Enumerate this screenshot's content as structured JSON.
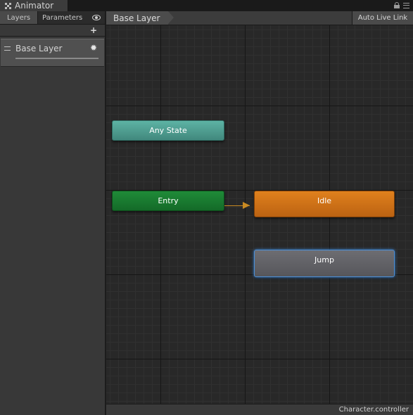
{
  "window": {
    "title": "Animator",
    "icons": [
      "animator-icon",
      "lock-icon",
      "menu-icon"
    ]
  },
  "left_panel": {
    "tabs": [
      {
        "label": "Layers",
        "active": true
      },
      {
        "label": "Parameters",
        "active": false
      }
    ],
    "icons": [
      "eye-icon",
      "plus-icon"
    ],
    "layers": [
      {
        "name": "Base Layer",
        "icons": [
          "drag-handle-icon",
          "gear-icon"
        ]
      }
    ]
  },
  "graph": {
    "breadcrumb": "Base Layer",
    "auto_live_link": "Auto Live Link",
    "nodes": {
      "any_state": {
        "label": "Any State",
        "color": "#5aa99b"
      },
      "entry": {
        "label": "Entry",
        "color": "#1b7d33"
      },
      "idle": {
        "label": "Idle",
        "color": "#d77419",
        "default_state": true
      },
      "jump": {
        "label": "Jump",
        "color": "#626267",
        "selected": true
      }
    },
    "transitions": [
      {
        "from": "Entry",
        "to": "Idle",
        "color": "#c98a22"
      }
    ]
  },
  "status_bar": {
    "controller": "Character.controller"
  }
}
